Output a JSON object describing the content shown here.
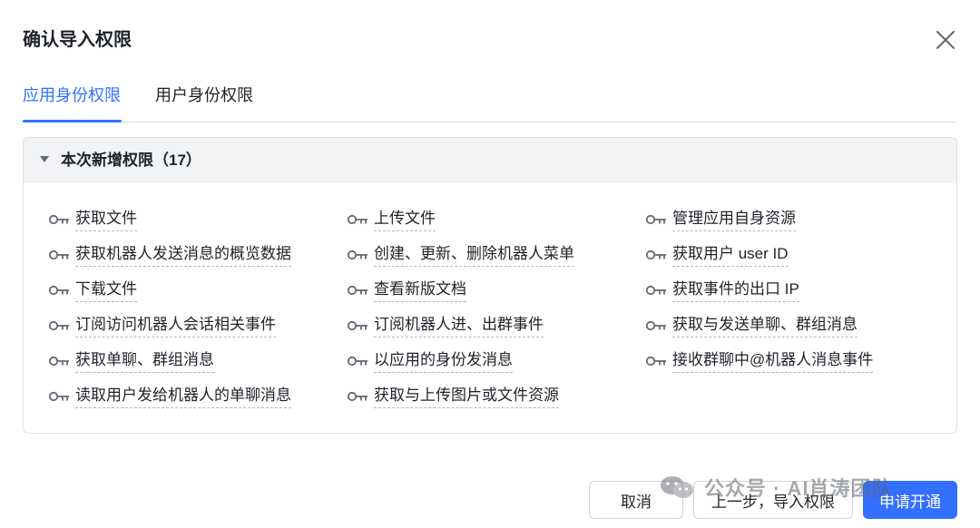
{
  "dialog": {
    "title": "确认导入权限"
  },
  "tabs": [
    {
      "label": "应用身份权限",
      "active": true
    },
    {
      "label": "用户身份权限",
      "active": false
    }
  ],
  "section": {
    "title": "本次新增权限（17）"
  },
  "permissions": {
    "col1": [
      "获取文件",
      "获取机器人发送消息的概览数据",
      "下载文件",
      "订阅访问机器人会话相关事件",
      "获取单聊、群组消息",
      "读取用户发给机器人的单聊消息"
    ],
    "col2": [
      "上传文件",
      "创建、更新、删除机器人菜单",
      "查看新版文档",
      "订阅机器人进、出群事件",
      "以应用的身份发消息",
      "获取与上传图片或文件资源"
    ],
    "col3": [
      "管理应用自身资源",
      "获取用户 user ID",
      "获取事件的出口 IP",
      "获取与发送单聊、群组消息",
      "接收群聊中@机器人消息事件"
    ]
  },
  "footer": {
    "cancel_label": "取消",
    "prev_label": "上一步，导入权限",
    "apply_label": "申请开通"
  },
  "watermark": {
    "text": "公众号 · AI肖涛团队",
    "icon": "wechat-icon"
  },
  "colors": {
    "accent": "#3370ff",
    "text": "#1f2329",
    "border": "#dee0e3",
    "header_bg": "#f2f3f5"
  }
}
